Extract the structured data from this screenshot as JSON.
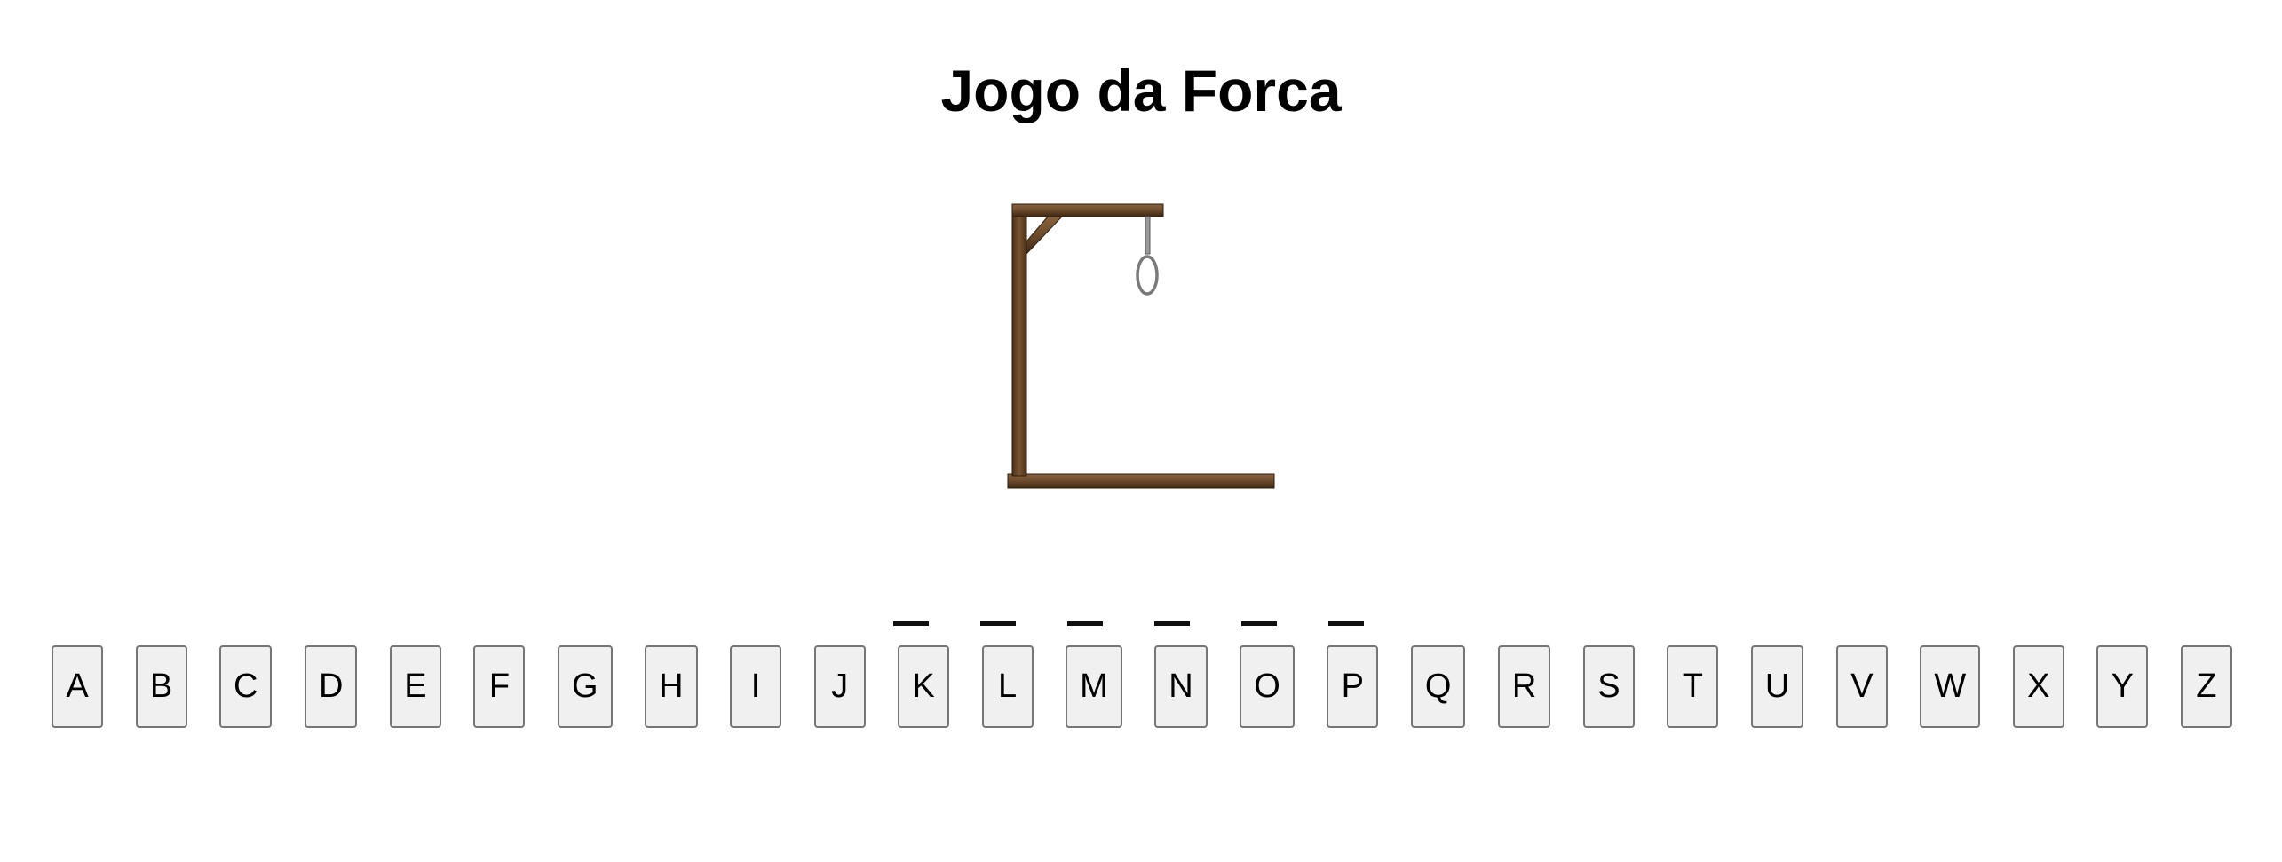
{
  "game": {
    "title": "Jogo da Forca",
    "word_length": 6,
    "wrong_guesses": 0
  },
  "colors": {
    "wood": "#6b4a2b",
    "rope": "#8a8a8a",
    "key_bg": "#f0f0f0",
    "key_border": "#767676"
  },
  "icons": {
    "gallows": "gallows-icon",
    "noose": "noose-icon"
  },
  "keyboard": {
    "letters": [
      "A",
      "B",
      "C",
      "D",
      "E",
      "F",
      "G",
      "H",
      "I",
      "J",
      "K",
      "L",
      "M",
      "N",
      "O",
      "P",
      "Q",
      "R",
      "S",
      "T",
      "U",
      "V",
      "W",
      "X",
      "Y",
      "Z"
    ]
  }
}
